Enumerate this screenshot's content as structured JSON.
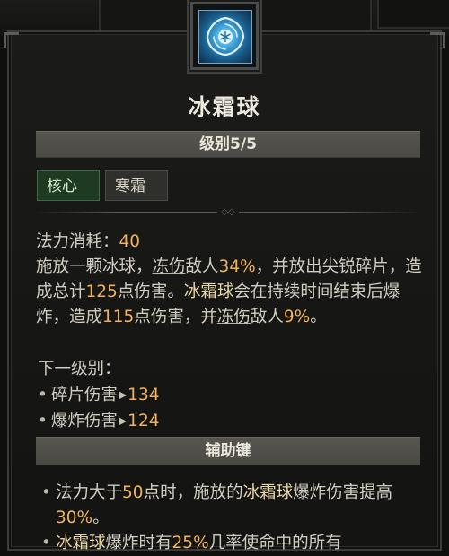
{
  "skill": {
    "name": "冰霜球",
    "icon": "frost-orb-skill-icon",
    "level": "级别5/5",
    "tags": [
      "核心",
      "寒霜"
    ]
  },
  "cost": {
    "label": "法力消耗：",
    "value": "40"
  },
  "description": {
    "p1": "施放一颗冰球，",
    "freeze1": "冻伤",
    "p2": "敌人",
    "pct1": "34%",
    "p3": "，并放出尖锐碎片，造成总计",
    "dmg1": "125",
    "p4": "点伤害。",
    "skill_ref": "冰霜球",
    "p5": "会在持续时间结束后爆炸，造成",
    "dmg2": "115",
    "p6": "点伤害，并",
    "freeze2": "冻伤",
    "p7": "敌人",
    "pct2": "9%",
    "p8": "。"
  },
  "next_level": {
    "label": "下一级别：",
    "rows": [
      {
        "name": "碎片伤害",
        "value": "134"
      },
      {
        "name": "爆炸伤害",
        "value": "124"
      }
    ]
  },
  "aux": {
    "header": "辅助键",
    "b1": {
      "t1": "法力大于",
      "v1": "50",
      "t2": "点时，施放的",
      "ref": "冰霜球",
      "t3": "爆炸伤害提高",
      "v2": "30%",
      "t4": "。"
    },
    "b2": {
      "ref": "冰霜球",
      "t1": "爆炸时有",
      "v1": "25%",
      "t2": "几率使命中的所有"
    }
  },
  "colors": {
    "accent": "#f0b25c",
    "core_tag": "#1e3a22",
    "panel": "#171715",
    "bar": "#504f49"
  }
}
